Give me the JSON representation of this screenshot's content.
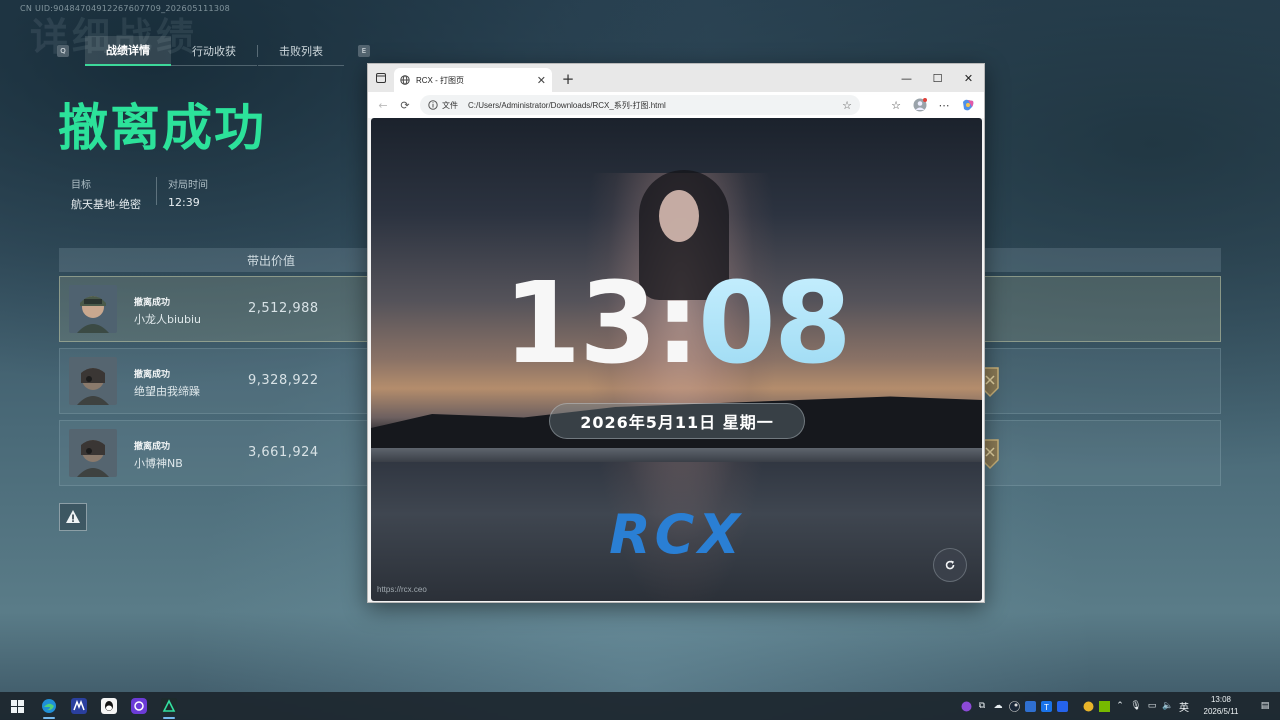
{
  "game": {
    "uid_line": "CN UID:90484704912267607709_202605111308",
    "bg_title": "详细战绩",
    "tabs": {
      "left_key": "Q",
      "right_key": "E",
      "items": [
        {
          "label": "战绩详情",
          "active": true
        },
        {
          "label": "行动收获",
          "active": false
        },
        {
          "label": "击败列表",
          "active": false
        }
      ]
    },
    "result_title": "撤离成功",
    "target_label": "目标",
    "target_value": "航天基地-绝密",
    "time_label": "对局时间",
    "time_value": "12:39",
    "table_header": "带出价值",
    "rows": [
      {
        "status": "撤离成功",
        "name": "小龙人biubiu",
        "value": "2,512,988",
        "highlight": true
      },
      {
        "status": "撤离成功",
        "name": "绝望由我缔躁",
        "value": "9,328,922",
        "highlight": false
      },
      {
        "status": "撤离成功",
        "name": "小博神NB",
        "value": "3,661,924",
        "highlight": false
      }
    ],
    "warn_icon": "warning-triangle-icon"
  },
  "browser": {
    "tab_title": "RCX - 打图页",
    "address_label": "文件",
    "url": "C:/Users/Administrator/Downloads/RCX_系列-打图.html",
    "page": {
      "clock_hours": "13",
      "clock_sep": ":",
      "clock_minutes": "08",
      "date_text": "2026年5月11日 星期一",
      "brand": "RCX",
      "footer_url": "https://rcx.ceo"
    }
  },
  "taskbar": {
    "time": "13:08",
    "date": "2026/5/11",
    "lang": "英"
  },
  "colors": {
    "accent_green": "#2ce29a",
    "brand_blue": "#2a7fd4",
    "clock_cyan": "#a8e2f6"
  }
}
